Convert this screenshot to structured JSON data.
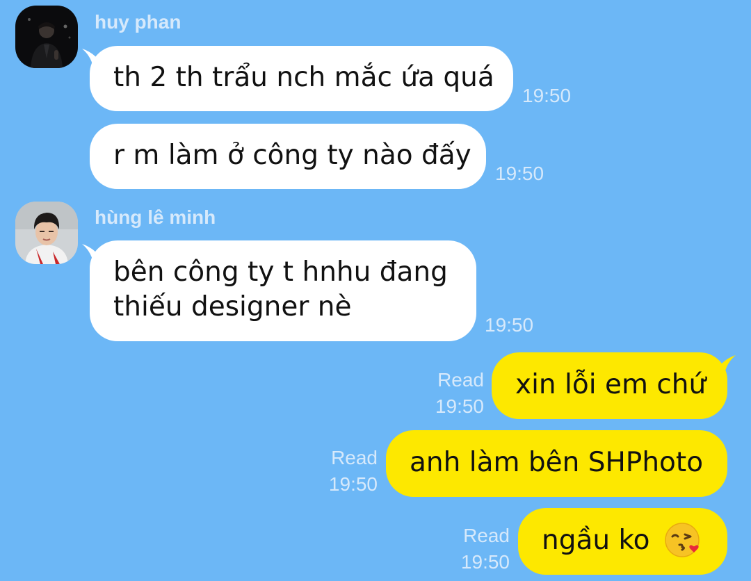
{
  "contacts": {
    "first": {
      "name": "huy phan"
    },
    "second": {
      "name": "hùng lê minh"
    }
  },
  "messages": [
    {
      "text": "th 2 th trẩu nch mắc ứa quá",
      "time": "19:50"
    },
    {
      "text": "r m làm ở công ty nào đấy",
      "time": "19:50"
    },
    {
      "line1": "bên công ty t hnhu đang",
      "line2": "thiếu designer nè",
      "time": "19:50"
    },
    {
      "text": "xin lỗi em chứ",
      "status": "Read",
      "time": "19:50"
    },
    {
      "text": "anh làm bên SHPhoto",
      "status": "Read",
      "time": "19:50"
    },
    {
      "text": "ngầu ko",
      "emoji": "kissing-face-with-heart-emoji",
      "status": "Read",
      "time": "19:50"
    }
  ],
  "colors": {
    "background": "#6cb7f6",
    "incoming_bubble": "#ffffff",
    "outgoing_bubble": "#fde800",
    "meta_text": "#d6e9fb"
  }
}
